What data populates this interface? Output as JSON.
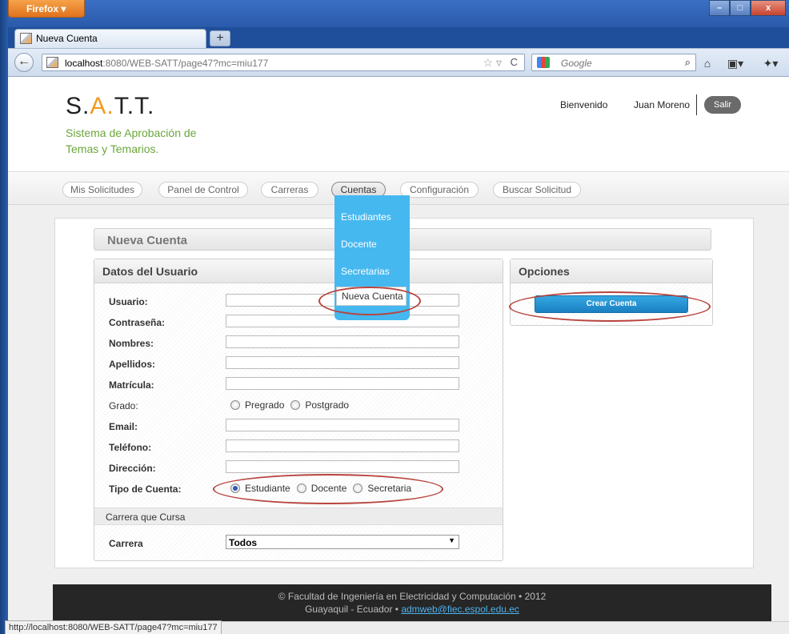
{
  "browser": {
    "menu_button": "Firefox",
    "window_controls": [
      "–",
      "□",
      "x"
    ],
    "tab_title": "Nueva Cuenta",
    "new_tab": "+",
    "url_host": "localhost",
    "url_path": ":8080/WEB-SATT/page47?mc=miu177",
    "search_placeholder": "Google",
    "status_url": "http://localhost:8080/WEB-SATT/page47?mc=miu177"
  },
  "site": {
    "logo_prefix": "S.",
    "logo_highlight": "A.",
    "logo_suffix": "T.T.",
    "tagline": "Sistema de Aprobación de Temas y Temarios.",
    "welcome": "Bienvenido",
    "user_name": "Juan Moreno",
    "logout": "Salir"
  },
  "menu": {
    "items": [
      {
        "label": "Mis Solicitudes"
      },
      {
        "label": "Panel de Control"
      },
      {
        "label": "Carreras"
      },
      {
        "label": "Cuentas",
        "active": true
      },
      {
        "label": "Configuración"
      },
      {
        "label": "Buscar Solicitud"
      }
    ],
    "dropdown": [
      "Estudiantes",
      "Docente",
      "Secretarias",
      "Nueva Cuenta"
    ]
  },
  "page": {
    "title": "Nueva Cuenta",
    "datos_title": "Datos del Usuario",
    "opciones_title": "Opciones",
    "create_button": "Crear Cuenta",
    "fields": {
      "usuario": "Usuario:",
      "contrasena": "Contraseña:",
      "nombres": "Nombres:",
      "apellidos": "Apellidos:",
      "matricula": "Matrícula:",
      "grado": "Grado:",
      "email": "Email:",
      "telefono": "Teléfono:",
      "direccion": "Dirección:",
      "tipo": "Tipo de Cuenta:"
    },
    "grado_options": [
      "Pregrado",
      "Postgrado"
    ],
    "tipo_options": [
      "Estudiante",
      "Docente",
      "Secretaria"
    ],
    "tipo_selected": "Estudiante",
    "carrera_section": "Carrera que Cursa",
    "carrera_label": "Carrera",
    "carrera_value": "Todos"
  },
  "footer": {
    "line1": "© Facultad de Ingeniería en Electricidad y Computación • 2012",
    "line2_prefix": "Guayaquil - Ecuador • ",
    "email": "admweb@fiec.espol.edu.ec"
  },
  "colors": {
    "accent_green": "#6ba63a",
    "accent_orange": "#f39a1c",
    "dropdown_blue": "#45b8f0",
    "button_blue": "#1a7fc1",
    "annotation_red": "#b8443e"
  }
}
